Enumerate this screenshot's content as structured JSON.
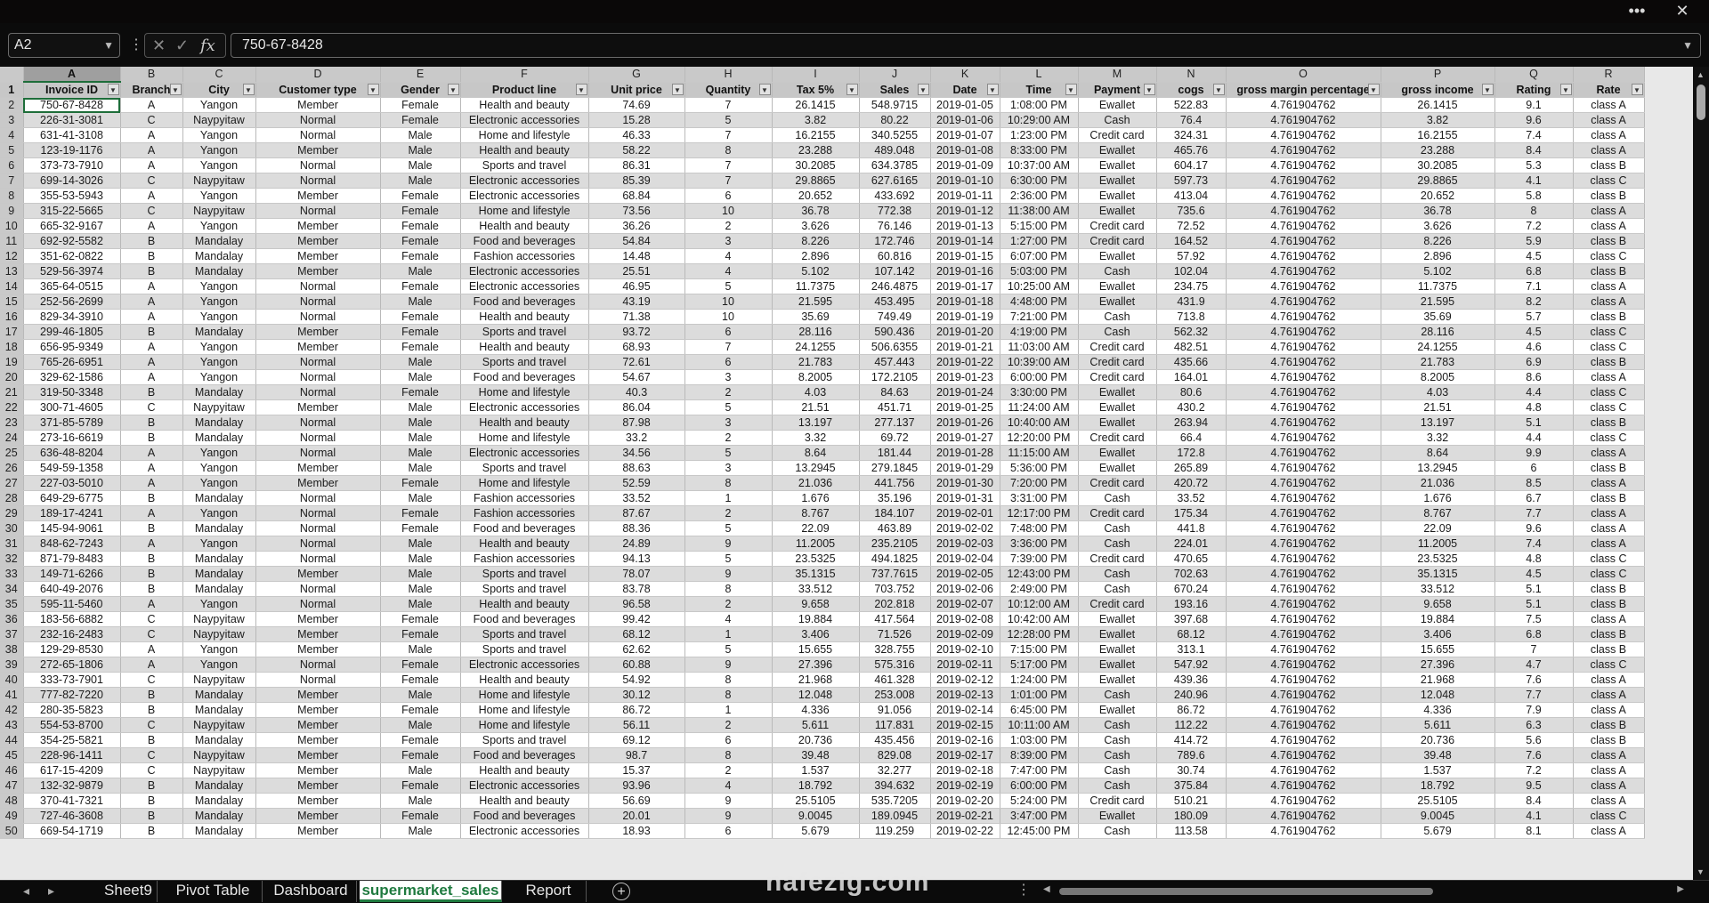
{
  "window": {
    "more_label": "•••",
    "close_label": "✕"
  },
  "formula_bar": {
    "name_box": "A2",
    "formula": "750-67-8428",
    "cancel_icon": "✕",
    "enter_icon": "✓",
    "fx_label": "fx"
  },
  "columns": [
    "A",
    "B",
    "C",
    "D",
    "E",
    "F",
    "G",
    "H",
    "I",
    "J",
    "K",
    "L",
    "M",
    "N",
    "O",
    "P",
    "Q",
    "R"
  ],
  "selected_column": "A",
  "headers": [
    "Invoice ID",
    "Branch",
    "City",
    "Customer type",
    "Gender",
    "Product line",
    "Unit price",
    "Quantity",
    "Tax 5%",
    "Sales",
    "Date",
    "Time",
    "Payment",
    "cogs",
    "gross margin percentage",
    "gross income",
    "Rating",
    "Rate"
  ],
  "rows": [
    [
      "750-67-8428",
      "A",
      "Yangon",
      "Member",
      "Female",
      "Health and beauty",
      "74.69",
      "7",
      "26.1415",
      "548.9715",
      "2019-01-05",
      "1:08:00 PM",
      "Ewallet",
      "522.83",
      "4.761904762",
      "26.1415",
      "9.1",
      "class A"
    ],
    [
      "226-31-3081",
      "C",
      "Naypyitaw",
      "Normal",
      "Female",
      "Electronic accessories",
      "15.28",
      "5",
      "3.82",
      "80.22",
      "2019-01-06",
      "10:29:00 AM",
      "Cash",
      "76.4",
      "4.761904762",
      "3.82",
      "9.6",
      "class A"
    ],
    [
      "631-41-3108",
      "A",
      "Yangon",
      "Normal",
      "Male",
      "Home and lifestyle",
      "46.33",
      "7",
      "16.2155",
      "340.5255",
      "2019-01-07",
      "1:23:00 PM",
      "Credit card",
      "324.31",
      "4.761904762",
      "16.2155",
      "7.4",
      "class A"
    ],
    [
      "123-19-1176",
      "A",
      "Yangon",
      "Member",
      "Male",
      "Health and beauty",
      "58.22",
      "8",
      "23.288",
      "489.048",
      "2019-01-08",
      "8:33:00 PM",
      "Ewallet",
      "465.76",
      "4.761904762",
      "23.288",
      "8.4",
      "class A"
    ],
    [
      "373-73-7910",
      "A",
      "Yangon",
      "Normal",
      "Male",
      "Sports and travel",
      "86.31",
      "7",
      "30.2085",
      "634.3785",
      "2019-01-09",
      "10:37:00 AM",
      "Ewallet",
      "604.17",
      "4.761904762",
      "30.2085",
      "5.3",
      "class B"
    ],
    [
      "699-14-3026",
      "C",
      "Naypyitaw",
      "Normal",
      "Male",
      "Electronic accessories",
      "85.39",
      "7",
      "29.8865",
      "627.6165",
      "2019-01-10",
      "6:30:00 PM",
      "Ewallet",
      "597.73",
      "4.761904762",
      "29.8865",
      "4.1",
      "class C"
    ],
    [
      "355-53-5943",
      "A",
      "Yangon",
      "Member",
      "Female",
      "Electronic accessories",
      "68.84",
      "6",
      "20.652",
      "433.692",
      "2019-01-11",
      "2:36:00 PM",
      "Ewallet",
      "413.04",
      "4.761904762",
      "20.652",
      "5.8",
      "class B"
    ],
    [
      "315-22-5665",
      "C",
      "Naypyitaw",
      "Normal",
      "Female",
      "Home and lifestyle",
      "73.56",
      "10",
      "36.78",
      "772.38",
      "2019-01-12",
      "11:38:00 AM",
      "Ewallet",
      "735.6",
      "4.761904762",
      "36.78",
      "8",
      "class A"
    ],
    [
      "665-32-9167",
      "A",
      "Yangon",
      "Member",
      "Female",
      "Health and beauty",
      "36.26",
      "2",
      "3.626",
      "76.146",
      "2019-01-13",
      "5:15:00 PM",
      "Credit card",
      "72.52",
      "4.761904762",
      "3.626",
      "7.2",
      "class A"
    ],
    [
      "692-92-5582",
      "B",
      "Mandalay",
      "Member",
      "Female",
      "Food and beverages",
      "54.84",
      "3",
      "8.226",
      "172.746",
      "2019-01-14",
      "1:27:00 PM",
      "Credit card",
      "164.52",
      "4.761904762",
      "8.226",
      "5.9",
      "class B"
    ],
    [
      "351-62-0822",
      "B",
      "Mandalay",
      "Member",
      "Female",
      "Fashion accessories",
      "14.48",
      "4",
      "2.896",
      "60.816",
      "2019-01-15",
      "6:07:00 PM",
      "Ewallet",
      "57.92",
      "4.761904762",
      "2.896",
      "4.5",
      "class C"
    ],
    [
      "529-56-3974",
      "B",
      "Mandalay",
      "Member",
      "Male",
      "Electronic accessories",
      "25.51",
      "4",
      "5.102",
      "107.142",
      "2019-01-16",
      "5:03:00 PM",
      "Cash",
      "102.04",
      "4.761904762",
      "5.102",
      "6.8",
      "class B"
    ],
    [
      "365-64-0515",
      "A",
      "Yangon",
      "Normal",
      "Female",
      "Electronic accessories",
      "46.95",
      "5",
      "11.7375",
      "246.4875",
      "2019-01-17",
      "10:25:00 AM",
      "Ewallet",
      "234.75",
      "4.761904762",
      "11.7375",
      "7.1",
      "class A"
    ],
    [
      "252-56-2699",
      "A",
      "Yangon",
      "Normal",
      "Male",
      "Food and beverages",
      "43.19",
      "10",
      "21.595",
      "453.495",
      "2019-01-18",
      "4:48:00 PM",
      "Ewallet",
      "431.9",
      "4.761904762",
      "21.595",
      "8.2",
      "class A"
    ],
    [
      "829-34-3910",
      "A",
      "Yangon",
      "Normal",
      "Female",
      "Health and beauty",
      "71.38",
      "10",
      "35.69",
      "749.49",
      "2019-01-19",
      "7:21:00 PM",
      "Cash",
      "713.8",
      "4.761904762",
      "35.69",
      "5.7",
      "class B"
    ],
    [
      "299-46-1805",
      "B",
      "Mandalay",
      "Member",
      "Female",
      "Sports and travel",
      "93.72",
      "6",
      "28.116",
      "590.436",
      "2019-01-20",
      "4:19:00 PM",
      "Cash",
      "562.32",
      "4.761904762",
      "28.116",
      "4.5",
      "class C"
    ],
    [
      "656-95-9349",
      "A",
      "Yangon",
      "Member",
      "Female",
      "Health and beauty",
      "68.93",
      "7",
      "24.1255",
      "506.6355",
      "2019-01-21",
      "11:03:00 AM",
      "Credit card",
      "482.51",
      "4.761904762",
      "24.1255",
      "4.6",
      "class C"
    ],
    [
      "765-26-6951",
      "A",
      "Yangon",
      "Normal",
      "Male",
      "Sports and travel",
      "72.61",
      "6",
      "21.783",
      "457.443",
      "2019-01-22",
      "10:39:00 AM",
      "Credit card",
      "435.66",
      "4.761904762",
      "21.783",
      "6.9",
      "class B"
    ],
    [
      "329-62-1586",
      "A",
      "Yangon",
      "Normal",
      "Male",
      "Food and beverages",
      "54.67",
      "3",
      "8.2005",
      "172.2105",
      "2019-01-23",
      "6:00:00 PM",
      "Credit card",
      "164.01",
      "4.761904762",
      "8.2005",
      "8.6",
      "class A"
    ],
    [
      "319-50-3348",
      "B",
      "Mandalay",
      "Normal",
      "Female",
      "Home and lifestyle",
      "40.3",
      "2",
      "4.03",
      "84.63",
      "2019-01-24",
      "3:30:00 PM",
      "Ewallet",
      "80.6",
      "4.761904762",
      "4.03",
      "4.4",
      "class C"
    ],
    [
      "300-71-4605",
      "C",
      "Naypyitaw",
      "Member",
      "Male",
      "Electronic accessories",
      "86.04",
      "5",
      "21.51",
      "451.71",
      "2019-01-25",
      "11:24:00 AM",
      "Ewallet",
      "430.2",
      "4.761904762",
      "21.51",
      "4.8",
      "class C"
    ],
    [
      "371-85-5789",
      "B",
      "Mandalay",
      "Normal",
      "Male",
      "Health and beauty",
      "87.98",
      "3",
      "13.197",
      "277.137",
      "2019-01-26",
      "10:40:00 AM",
      "Ewallet",
      "263.94",
      "4.761904762",
      "13.197",
      "5.1",
      "class B"
    ],
    [
      "273-16-6619",
      "B",
      "Mandalay",
      "Normal",
      "Male",
      "Home and lifestyle",
      "33.2",
      "2",
      "3.32",
      "69.72",
      "2019-01-27",
      "12:20:00 PM",
      "Credit card",
      "66.4",
      "4.761904762",
      "3.32",
      "4.4",
      "class C"
    ],
    [
      "636-48-8204",
      "A",
      "Yangon",
      "Normal",
      "Male",
      "Electronic accessories",
      "34.56",
      "5",
      "8.64",
      "181.44",
      "2019-01-28",
      "11:15:00 AM",
      "Ewallet",
      "172.8",
      "4.761904762",
      "8.64",
      "9.9",
      "class A"
    ],
    [
      "549-59-1358",
      "A",
      "Yangon",
      "Member",
      "Male",
      "Sports and travel",
      "88.63",
      "3",
      "13.2945",
      "279.1845",
      "2019-01-29",
      "5:36:00 PM",
      "Ewallet",
      "265.89",
      "4.761904762",
      "13.2945",
      "6",
      "class B"
    ],
    [
      "227-03-5010",
      "A",
      "Yangon",
      "Member",
      "Female",
      "Home and lifestyle",
      "52.59",
      "8",
      "21.036",
      "441.756",
      "2019-01-30",
      "7:20:00 PM",
      "Credit card",
      "420.72",
      "4.761904762",
      "21.036",
      "8.5",
      "class A"
    ],
    [
      "649-29-6775",
      "B",
      "Mandalay",
      "Normal",
      "Male",
      "Fashion accessories",
      "33.52",
      "1",
      "1.676",
      "35.196",
      "2019-01-31",
      "3:31:00 PM",
      "Cash",
      "33.52",
      "4.761904762",
      "1.676",
      "6.7",
      "class B"
    ],
    [
      "189-17-4241",
      "A",
      "Yangon",
      "Normal",
      "Female",
      "Fashion accessories",
      "87.67",
      "2",
      "8.767",
      "184.107",
      "2019-02-01",
      "12:17:00 PM",
      "Credit card",
      "175.34",
      "4.761904762",
      "8.767",
      "7.7",
      "class A"
    ],
    [
      "145-94-9061",
      "B",
      "Mandalay",
      "Normal",
      "Female",
      "Food and beverages",
      "88.36",
      "5",
      "22.09",
      "463.89",
      "2019-02-02",
      "7:48:00 PM",
      "Cash",
      "441.8",
      "4.761904762",
      "22.09",
      "9.6",
      "class A"
    ],
    [
      "848-62-7243",
      "A",
      "Yangon",
      "Normal",
      "Male",
      "Health and beauty",
      "24.89",
      "9",
      "11.2005",
      "235.2105",
      "2019-02-03",
      "3:36:00 PM",
      "Cash",
      "224.01",
      "4.761904762",
      "11.2005",
      "7.4",
      "class A"
    ],
    [
      "871-79-8483",
      "B",
      "Mandalay",
      "Normal",
      "Male",
      "Fashion accessories",
      "94.13",
      "5",
      "23.5325",
      "494.1825",
      "2019-02-04",
      "7:39:00 PM",
      "Credit card",
      "470.65",
      "4.761904762",
      "23.5325",
      "4.8",
      "class C"
    ],
    [
      "149-71-6266",
      "B",
      "Mandalay",
      "Member",
      "Male",
      "Sports and travel",
      "78.07",
      "9",
      "35.1315",
      "737.7615",
      "2019-02-05",
      "12:43:00 PM",
      "Cash",
      "702.63",
      "4.761904762",
      "35.1315",
      "4.5",
      "class C"
    ],
    [
      "640-49-2076",
      "B",
      "Mandalay",
      "Normal",
      "Male",
      "Sports and travel",
      "83.78",
      "8",
      "33.512",
      "703.752",
      "2019-02-06",
      "2:49:00 PM",
      "Cash",
      "670.24",
      "4.761904762",
      "33.512",
      "5.1",
      "class B"
    ],
    [
      "595-11-5460",
      "A",
      "Yangon",
      "Normal",
      "Male",
      "Health and beauty",
      "96.58",
      "2",
      "9.658",
      "202.818",
      "2019-02-07",
      "10:12:00 AM",
      "Credit card",
      "193.16",
      "4.761904762",
      "9.658",
      "5.1",
      "class B"
    ],
    [
      "183-56-6882",
      "C",
      "Naypyitaw",
      "Member",
      "Female",
      "Food and beverages",
      "99.42",
      "4",
      "19.884",
      "417.564",
      "2019-02-08",
      "10:42:00 AM",
      "Ewallet",
      "397.68",
      "4.761904762",
      "19.884",
      "7.5",
      "class A"
    ],
    [
      "232-16-2483",
      "C",
      "Naypyitaw",
      "Member",
      "Female",
      "Sports and travel",
      "68.12",
      "1",
      "3.406",
      "71.526",
      "2019-02-09",
      "12:28:00 PM",
      "Ewallet",
      "68.12",
      "4.761904762",
      "3.406",
      "6.8",
      "class B"
    ],
    [
      "129-29-8530",
      "A",
      "Yangon",
      "Member",
      "Male",
      "Sports and travel",
      "62.62",
      "5",
      "15.655",
      "328.755",
      "2019-02-10",
      "7:15:00 PM",
      "Ewallet",
      "313.1",
      "4.761904762",
      "15.655",
      "7",
      "class B"
    ],
    [
      "272-65-1806",
      "A",
      "Yangon",
      "Normal",
      "Female",
      "Electronic accessories",
      "60.88",
      "9",
      "27.396",
      "575.316",
      "2019-02-11",
      "5:17:00 PM",
      "Ewallet",
      "547.92",
      "4.761904762",
      "27.396",
      "4.7",
      "class C"
    ],
    [
      "333-73-7901",
      "C",
      "Naypyitaw",
      "Normal",
      "Female",
      "Health and beauty",
      "54.92",
      "8",
      "21.968",
      "461.328",
      "2019-02-12",
      "1:24:00 PM",
      "Ewallet",
      "439.36",
      "4.761904762",
      "21.968",
      "7.6",
      "class A"
    ],
    [
      "777-82-7220",
      "B",
      "Mandalay",
      "Member",
      "Male",
      "Home and lifestyle",
      "30.12",
      "8",
      "12.048",
      "253.008",
      "2019-02-13",
      "1:01:00 PM",
      "Cash",
      "240.96",
      "4.761904762",
      "12.048",
      "7.7",
      "class A"
    ],
    [
      "280-35-5823",
      "B",
      "Mandalay",
      "Member",
      "Female",
      "Home and lifestyle",
      "86.72",
      "1",
      "4.336",
      "91.056",
      "2019-02-14",
      "6:45:00 PM",
      "Ewallet",
      "86.72",
      "4.761904762",
      "4.336",
      "7.9",
      "class A"
    ],
    [
      "554-53-8700",
      "C",
      "Naypyitaw",
      "Member",
      "Male",
      "Home and lifestyle",
      "56.11",
      "2",
      "5.611",
      "117.831",
      "2019-02-15",
      "10:11:00 AM",
      "Cash",
      "112.22",
      "4.761904762",
      "5.611",
      "6.3",
      "class B"
    ],
    [
      "354-25-5821",
      "B",
      "Mandalay",
      "Member",
      "Female",
      "Sports and travel",
      "69.12",
      "6",
      "20.736",
      "435.456",
      "2019-02-16",
      "1:03:00 PM",
      "Cash",
      "414.72",
      "4.761904762",
      "20.736",
      "5.6",
      "class B"
    ],
    [
      "228-96-1411",
      "C",
      "Naypyitaw",
      "Member",
      "Female",
      "Food and beverages",
      "98.7",
      "8",
      "39.48",
      "829.08",
      "2019-02-17",
      "8:39:00 PM",
      "Cash",
      "789.6",
      "4.761904762",
      "39.48",
      "7.6",
      "class A"
    ],
    [
      "617-15-4209",
      "C",
      "Naypyitaw",
      "Member",
      "Male",
      "Health and beauty",
      "15.37",
      "2",
      "1.537",
      "32.277",
      "2019-02-18",
      "7:47:00 PM",
      "Cash",
      "30.74",
      "4.761904762",
      "1.537",
      "7.2",
      "class A"
    ],
    [
      "132-32-9879",
      "B",
      "Mandalay",
      "Member",
      "Female",
      "Electronic accessories",
      "93.96",
      "4",
      "18.792",
      "394.632",
      "2019-02-19",
      "6:00:00 PM",
      "Cash",
      "375.84",
      "4.761904762",
      "18.792",
      "9.5",
      "class A"
    ],
    [
      "370-41-7321",
      "B",
      "Mandalay",
      "Member",
      "Male",
      "Health and beauty",
      "56.69",
      "9",
      "25.5105",
      "535.7205",
      "2019-02-20",
      "5:24:00 PM",
      "Credit card",
      "510.21",
      "4.761904762",
      "25.5105",
      "8.4",
      "class A"
    ],
    [
      "727-46-3608",
      "B",
      "Mandalay",
      "Member",
      "Female",
      "Food and beverages",
      "20.01",
      "9",
      "9.0045",
      "189.0945",
      "2019-02-21",
      "3:47:00 PM",
      "Ewallet",
      "180.09",
      "4.761904762",
      "9.0045",
      "4.1",
      "class C"
    ],
    [
      "669-54-1719",
      "B",
      "Mandalay",
      "Member",
      "Male",
      "Electronic accessories",
      "18.93",
      "6",
      "5.679",
      "119.259",
      "2019-02-22",
      "12:45:00 PM",
      "Cash",
      "113.58",
      "4.761904762",
      "5.679",
      "8.1",
      "class A"
    ]
  ],
  "sheet_tabs": [
    "Sheet9",
    "Pivot Table",
    "Dashboard",
    "supermarket_sales",
    "Report"
  ],
  "active_tab": "supermarket_sales",
  "tab_more": "⋮",
  "add_sheet_label": "+",
  "watermark": "nafezig.com"
}
